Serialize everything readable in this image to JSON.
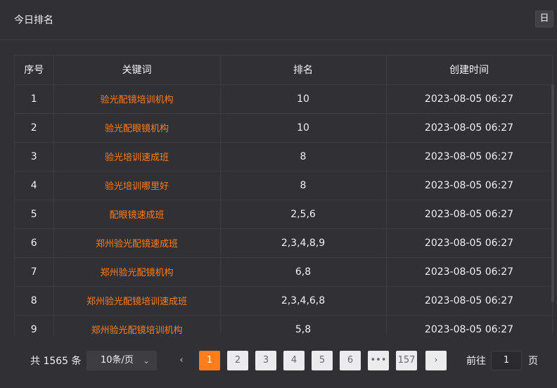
{
  "header": {
    "title": "今日排名",
    "day_button": "日"
  },
  "table": {
    "columns": [
      "序号",
      "关键词",
      "排名",
      "创建时间"
    ],
    "rows": [
      {
        "idx": "1",
        "keyword": "验光配镜培训机构",
        "rank": "10",
        "time": "2023-08-05 06:27"
      },
      {
        "idx": "2",
        "keyword": "验光配眼镜机构",
        "rank": "10",
        "time": "2023-08-05 06:27"
      },
      {
        "idx": "3",
        "keyword": "验光培训速成班",
        "rank": "8",
        "time": "2023-08-05 06:27"
      },
      {
        "idx": "4",
        "keyword": "验光培训哪里好",
        "rank": "8",
        "time": "2023-08-05 06:27"
      },
      {
        "idx": "5",
        "keyword": "配眼镜速成班",
        "rank": "2,5,6",
        "time": "2023-08-05 06:27"
      },
      {
        "idx": "6",
        "keyword": "郑州验光配镜速成班",
        "rank": "2,3,4,8,9",
        "time": "2023-08-05 06:27"
      },
      {
        "idx": "7",
        "keyword": "郑州验光配镜机构",
        "rank": "6,8",
        "time": "2023-08-05 06:27"
      },
      {
        "idx": "8",
        "keyword": "郑州验光配镜培训速成班",
        "rank": "2,3,4,6,8",
        "time": "2023-08-05 06:27"
      },
      {
        "idx": "9",
        "keyword": "郑州验光配镜培训机构",
        "rank": "5,8",
        "time": "2023-08-05 06:27"
      }
    ]
  },
  "pager": {
    "total": "共 1565 条",
    "page_size": "10条/页",
    "pages": [
      "1",
      "2",
      "3",
      "4",
      "5",
      "6",
      "•••",
      "157"
    ],
    "current": "1",
    "prev_icon": "chevron-left-icon",
    "next_icon": "chevron-right-icon",
    "goto_label": "前往",
    "goto_value": "1",
    "page_suffix": "页"
  },
  "colors": {
    "accent": "#ff7d1a",
    "background": "#313135"
  }
}
